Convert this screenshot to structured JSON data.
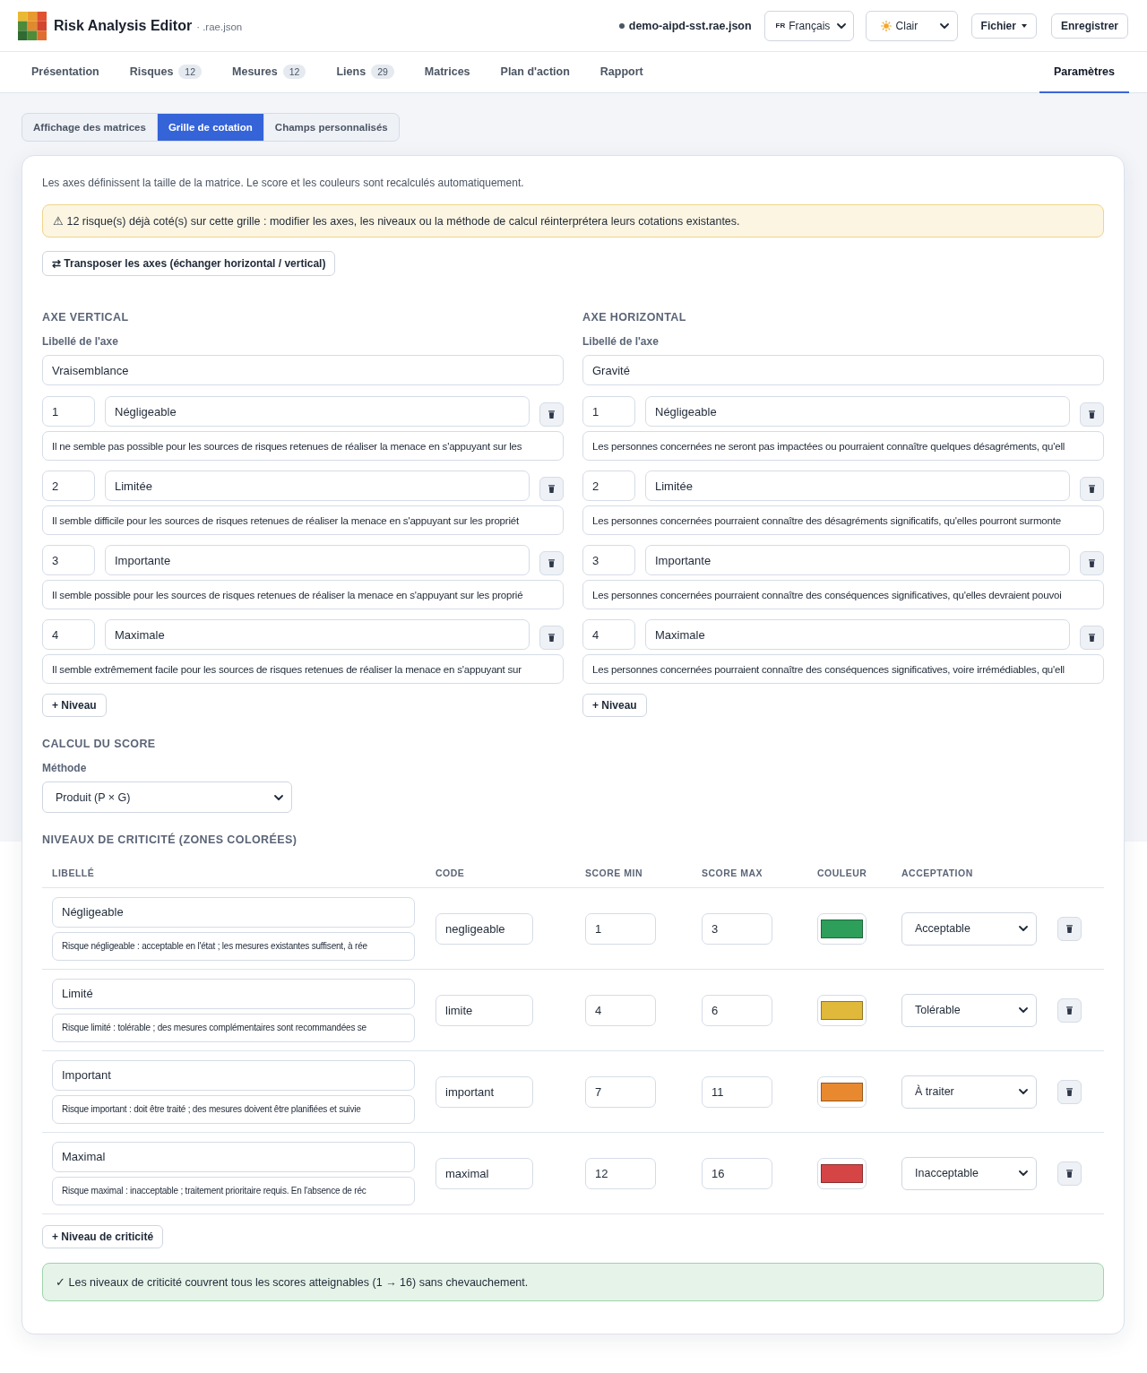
{
  "header": {
    "title": "Risk Analysis Editor",
    "subtitle": "· .rae.json",
    "file_name": "demo-aipd-sst.rae.json",
    "language": {
      "flag": "FR",
      "value": "Français"
    },
    "theme": {
      "value": "Clair"
    },
    "file_menu": "Fichier",
    "save_button": "Enregistrer"
  },
  "nav": {
    "tabs": [
      {
        "label": "Présentation",
        "selected": false
      },
      {
        "label": "Risques",
        "count": "12",
        "selected": false
      },
      {
        "label": "Mesures",
        "count": "12",
        "selected": false
      },
      {
        "label": "Liens",
        "count": "29",
        "selected": false
      },
      {
        "label": "Matrices",
        "selected": false
      },
      {
        "label": "Plan d'action",
        "selected": false
      },
      {
        "label": "Rapport",
        "selected": false
      }
    ],
    "end_tabs": [
      {
        "label": "Paramètres",
        "selected": true
      }
    ]
  },
  "subtabs": [
    {
      "label": "Affichage des matrices",
      "selected": false
    },
    {
      "label": "Grille de cotation",
      "selected": true
    },
    {
      "label": "Champs personnalisés",
      "selected": false
    }
  ],
  "grid": {
    "intro": "Les axes définissent la taille de la matrice. Le score et les couleurs sont recalculés automatiquement.",
    "warning": "⚠ 12 risque(s) déjà coté(s) sur cette grille : modifier les axes, les niveaux ou la méthode de calcul réinterprétera leurs cotations existantes.",
    "transpose_button": "⇄ Transposer les axes (échanger horizontal / vertical)",
    "axes": [
      {
        "heading": "AXE VERTICAL",
        "label_caption": "Libellé de l'axe",
        "name": "Vraisemblance",
        "levels": [
          {
            "value": "1",
            "name": "Négligeable",
            "description": "Il ne semble pas possible pour les sources de risques retenues de réaliser la menace en s'appuyant sur les"
          },
          {
            "value": "2",
            "name": "Limitée",
            "description": "Il semble difficile pour les sources de risques retenues de réaliser la menace en s'appuyant sur les propriét"
          },
          {
            "value": "3",
            "name": "Importante",
            "description": "Il semble possible pour les sources de risques retenues de réaliser la menace en s'appuyant sur les proprié"
          },
          {
            "value": "4",
            "name": "Maximale",
            "description": "Il semble extrêmement facile pour les sources de risques retenues de réaliser la menace en s'appuyant sur"
          }
        ],
        "add_button": "+ Niveau"
      },
      {
        "heading": "AXE HORIZONTAL",
        "label_caption": "Libellé de l'axe",
        "name": "Gravité",
        "levels": [
          {
            "value": "1",
            "name": "Négligeable",
            "description": "Les personnes concernées ne seront pas impactées ou pourraient connaître quelques désagréments, qu'ell"
          },
          {
            "value": "2",
            "name": "Limitée",
            "description": "Les personnes concernées pourraient connaître des désagréments significatifs, qu'elles pourront surmonte"
          },
          {
            "value": "3",
            "name": "Importante",
            "description": "Les personnes concernées pourraient connaître des conséquences significatives, qu'elles devraient pouvoi"
          },
          {
            "value": "4",
            "name": "Maximale",
            "description": "Les personnes concernées pourraient connaître des conséquences significatives, voire irrémédiables, qu'ell"
          }
        ],
        "add_button": "+ Niveau"
      }
    ],
    "score": {
      "heading": "CALCUL DU SCORE",
      "method_caption": "Méthode",
      "method": "Produit (P × G)"
    },
    "criticality": {
      "heading": "NIVEAUX DE CRITICITÉ (ZONES COLORÉES)",
      "columns": [
        "LIBELLÉ",
        "CODE",
        "SCORE MIN",
        "SCORE MAX",
        "COULEUR",
        "ACCEPTATION"
      ],
      "levels": [
        {
          "label": "Négligeable",
          "description": "Risque négligeable : acceptable en l'état ; les mesures existantes suffisent, à rée",
          "code": "negligeable",
          "score_min": "1",
          "score_max": "3",
          "color": "#2e9e5b",
          "acceptation": "Acceptable"
        },
        {
          "label": "Limité",
          "description": "Risque limité : tolérable ; des mesures complémentaires sont recommandées se",
          "code": "limite",
          "score_min": "4",
          "score_max": "6",
          "color": "#e0b93a",
          "acceptation": "Tolérable"
        },
        {
          "label": "Important",
          "description": "Risque important : doit être traité ; des mesures doivent être planifiées et suivie",
          "code": "important",
          "score_min": "7",
          "score_max": "11",
          "color": "#e8892f",
          "acceptation": "À traiter"
        },
        {
          "label": "Maximal",
          "description": "Risque maximal : inacceptable ; traitement prioritaire requis. En l'absence de réc",
          "code": "maximal",
          "score_min": "12",
          "score_max": "16",
          "color": "#d64545",
          "acceptation": "Inacceptable"
        }
      ],
      "add_button": "+ Niveau de criticité"
    },
    "coverage_message": "✓ Les niveaux de criticité couvrent tous les scores atteignables (1 → 16) sans chevauchement."
  }
}
